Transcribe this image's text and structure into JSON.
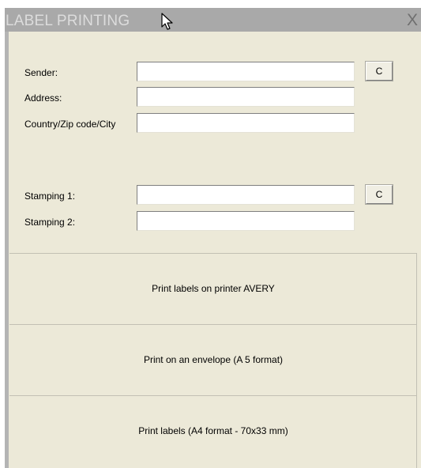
{
  "window": {
    "title": "LABEL PRINTING",
    "close_label": "X"
  },
  "form": {
    "sender_label": "Sender:",
    "sender_value": "",
    "address_label": "Address:",
    "address_value": "",
    "country_label": "Country/Zip code/City",
    "country_value": "",
    "stamping1_label": "Stamping 1:",
    "stamping1_value": "",
    "stamping2_label": "Stamping 2:",
    "stamping2_value": "",
    "clear_label": "C"
  },
  "actions": {
    "print_avery": "Print labels on printer AVERY",
    "print_envelope": "Print on an envelope (A 5 format)",
    "print_a4": "Print labels (A4 format - 70x33 mm)"
  },
  "icons": {
    "cursor": "mouse-pointer-icon"
  },
  "colors": {
    "title_bar": "#a9a9a9",
    "window_bg": "#ece9d8",
    "input_bg": "#ffffff"
  }
}
